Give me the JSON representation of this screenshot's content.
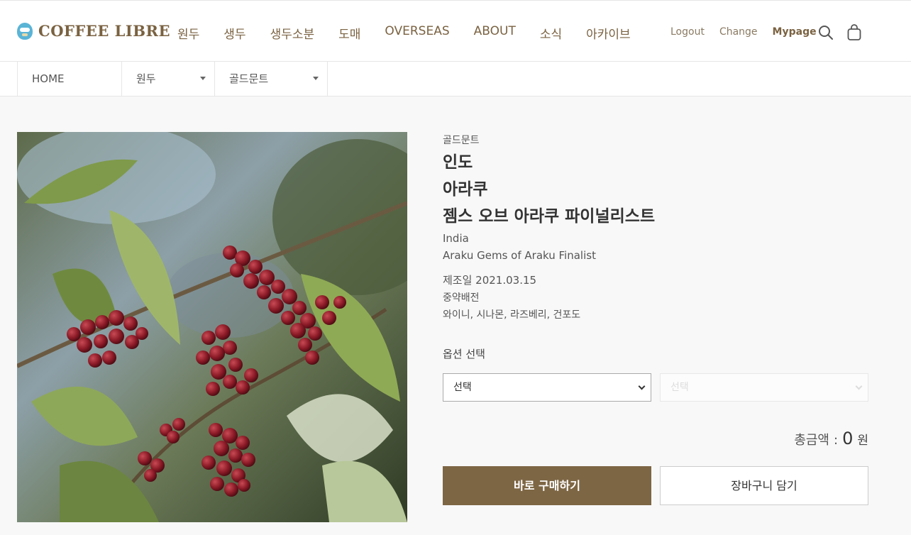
{
  "header": {
    "logo_text": "COFFEE LIBRE",
    "nav": [
      "원두",
      "생두",
      "생두소분",
      "도매",
      "OVERSEAS",
      "ABOUT",
      "소식",
      "아카이브"
    ],
    "util": {
      "logout": "Logout",
      "change": "Change",
      "mypage": "Mypage"
    },
    "icons": {
      "search": "search-icon",
      "cart": "shopping-bag-icon"
    }
  },
  "breadcrumb": {
    "home": "HOME",
    "category": "원두",
    "subcategory": "골드문트"
  },
  "product": {
    "brand": "골드문트",
    "title_lines": [
      "인도",
      "아라쿠",
      "젬스 오브 아라쿠 파이널리스트"
    ],
    "title_en_lines": [
      "India",
      "Araku Gems of Araku Finalist"
    ],
    "date": "제조일 2021.03.15",
    "roast": "중약배전",
    "notes": "와이니, 시나몬, 라즈베리, 건포도"
  },
  "options": {
    "label": "옵션 선택",
    "select1": "선택",
    "select2": "선택"
  },
  "total": {
    "label": "총금액",
    "colon": ":",
    "amount": "0",
    "unit": "원"
  },
  "buttons": {
    "buy": "바로 구매하기",
    "cart": "장바구니 담기"
  },
  "colors": {
    "brand": "#7d6644",
    "logo": "#7a6241"
  }
}
